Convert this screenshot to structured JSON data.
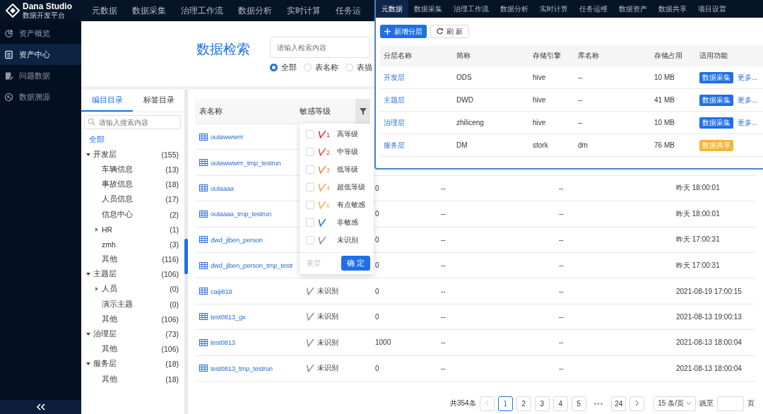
{
  "topbar": {
    "logo": "Dana Studio",
    "logo_sub": "数据开发平台",
    "items": [
      {
        "label": "元数据"
      },
      {
        "label": "数据采集"
      },
      {
        "label": "治理工作流"
      },
      {
        "label": "数据分析"
      },
      {
        "label": "实时计算"
      },
      {
        "label": "任务运"
      }
    ]
  },
  "sidebar": {
    "items": [
      {
        "label": "资产概览",
        "selected": false
      },
      {
        "label": "资产中心",
        "selected": true
      },
      {
        "label": "问题数据",
        "selected": false
      },
      {
        "label": "数据溯源",
        "selected": false
      }
    ]
  },
  "search": {
    "title": "数据检索",
    "placeholder": "请输入检索内容",
    "scopes": [
      {
        "label": "全部",
        "selected": true
      },
      {
        "label": "表名称",
        "selected": false
      },
      {
        "label": "表描",
        "selected": false
      }
    ]
  },
  "catalog": {
    "tabs": [
      {
        "label": "编目目录",
        "selected": true
      },
      {
        "label": "标签目录",
        "selected": false
      }
    ],
    "placeholder": "请输入搜索内容",
    "all_item": {
      "label": "全部",
      "selected": true
    },
    "nodes": [
      {
        "label": "开发层",
        "count": "(155)",
        "expanded": true,
        "children": [
          {
            "label": "车辆信息",
            "count": "(13)"
          },
          {
            "label": "事故信息",
            "count": "(18)"
          },
          {
            "label": "人员信息",
            "count": "(17)"
          },
          {
            "label": "信息中心",
            "count": "(2)"
          },
          {
            "label": "HR",
            "count": "(1)",
            "expanded": false
          },
          {
            "label": "zmh",
            "count": "(3)"
          },
          {
            "label": "其他",
            "count": "(116)"
          }
        ]
      },
      {
        "label": "主题层",
        "count": "(106)",
        "expanded": true,
        "children": [
          {
            "label": "人员",
            "count": "(0)",
            "expanded": false
          },
          {
            "label": "演示主题",
            "count": "(0)"
          },
          {
            "label": "其他",
            "count": "(106)"
          }
        ]
      },
      {
        "label": "治理层",
        "count": "(73)",
        "expanded": true,
        "children": [
          {
            "label": "其他",
            "count": "(106)"
          }
        ]
      },
      {
        "label": "服务层",
        "count": "(18)",
        "expanded": true,
        "children": [
          {
            "label": "其他",
            "count": "(18)"
          }
        ]
      }
    ]
  },
  "table": {
    "columns": [
      {
        "label": "表名称"
      },
      {
        "label": "敏感等级"
      }
    ],
    "rows": [
      {
        "name": "outawwwrrr"
      },
      {
        "name": "outawwwrrr_tmp_testrun"
      },
      {
        "name": "outaaaa",
        "column_3": "0",
        "column_4": "--",
        "column_5": "--",
        "column_6": "昨天 18:00:01"
      },
      {
        "name": "outaaaa_tmp_testrun",
        "column_3": "0",
        "column_4": "--",
        "column_5": "--",
        "column_6": "昨天 18:00:01"
      },
      {
        "name": "dwd_jiben_person",
        "column_3": "0",
        "column_4": "--",
        "column_5": "--",
        "column_6": "昨天 17:00:31"
      },
      {
        "name": "dwd_jiben_person_tmp_testr",
        "column_3": "0",
        "column_4": "--",
        "column_5": "--",
        "column_6": "昨天 17:00:31"
      },
      {
        "name": "caiji819",
        "level": {
          "label": "未识别",
          "color": "#8c8c8c"
        },
        "column_3": "0",
        "column_4": "--",
        "column_5": "--",
        "column_6": "2021-08-19 17:00:15"
      },
      {
        "name": "test0813_gx",
        "level": {
          "label": "未识别",
          "color": "#8c8c8c"
        },
        "column_3": "0",
        "column_4": "--",
        "column_5": "--",
        "column_6": "2021-08-13 19:00:13"
      },
      {
        "name": "test0813",
        "level": {
          "label": "未识别",
          "color": "#8c8c8c"
        },
        "column_3": "1000",
        "column_4": "--",
        "column_5": "--",
        "column_6": "2021-08-13 18:00:04"
      },
      {
        "name": "test0813_tmp_testrun",
        "level": {
          "label": "未识别",
          "color": "#8c8c8c"
        },
        "column_3": "0",
        "column_4": "--",
        "column_5": "--",
        "column_6": "2021-08-13 18:00:04"
      }
    ]
  },
  "filter_menu": {
    "options": [
      {
        "label": "高等级",
        "badge": "1",
        "color": "#e0202b",
        "checked": false
      },
      {
        "label": "中等级",
        "badge": "2",
        "color": "#e8483a",
        "checked": false
      },
      {
        "label": "低等级",
        "badge": "3",
        "color": "#f07e3a",
        "checked": false
      },
      {
        "label": "超低等级",
        "badge": "4",
        "color": "#f39a45",
        "checked": false
      },
      {
        "label": "有点敏感",
        "badge": "6",
        "color": "#e5b847",
        "checked": false
      },
      {
        "label": "非敏感",
        "color": "#1e6fe8",
        "checked": false
      },
      {
        "label": "未识别",
        "color": "#8c8c8c",
        "checked": false
      }
    ],
    "reset": {
      "label": "重置",
      "disabled": true
    },
    "confirm": "确 定"
  },
  "pagination": {
    "total": "共354条",
    "pages": [
      {
        "label": "1",
        "selected": true
      },
      {
        "label": "2",
        "selected": false
      },
      {
        "label": "3",
        "selected": false
      },
      {
        "label": "4",
        "selected": false
      },
      {
        "label": "5",
        "selected": false
      }
    ],
    "ellipsis": "•••",
    "last": {
      "label": "24",
      "selected": false
    },
    "page_size": "15 条/页",
    "jump_label": "跳至",
    "page_unit": "页"
  },
  "overlay": {
    "nav": [
      {
        "label": "元数据",
        "selected": true
      },
      {
        "label": "数据采集",
        "selected": false
      },
      {
        "label": "治理工作流",
        "selected": false
      },
      {
        "label": "数据分析",
        "selected": false
      },
      {
        "label": "实时计算",
        "selected": false
      },
      {
        "label": "任务运维",
        "selected": false
      },
      {
        "label": "数据资产",
        "selected": false
      },
      {
        "label": "数据共享",
        "selected": false
      },
      {
        "label": "项目设置",
        "selected": false
      }
    ],
    "add_button": "新增分层",
    "refresh_button": "刷 新",
    "columns": [
      "分层名称",
      "简称",
      "存储引擎",
      "库名称",
      "存储占用",
      "适用功能"
    ],
    "rows": [
      {
        "name": "开发层",
        "short": "ODS",
        "engine": "hive",
        "db": "--",
        "size": "10 MB",
        "tag": {
          "label": "数据采集",
          "color": "#1e6fe8"
        },
        "more": "更多..."
      },
      {
        "name": "主题层",
        "short": "DWD",
        "engine": "hive",
        "db": "--",
        "size": "41 MB",
        "tag": {
          "label": "数据采集",
          "color": "#1e6fe8"
        },
        "more": "更多..."
      },
      {
        "name": "治理层",
        "short": "zhiliceng",
        "engine": "hive",
        "db": "--",
        "size": "10 MB",
        "tag": {
          "label": "数据采集",
          "color": "#1e6fe8"
        },
        "more": "更多..."
      },
      {
        "name": "服务层",
        "short": "DM",
        "engine": "stork",
        "db": "dm",
        "size": "76 MB",
        "tag": {
          "label": "数据共享",
          "color": "#f5b43c"
        }
      }
    ]
  }
}
